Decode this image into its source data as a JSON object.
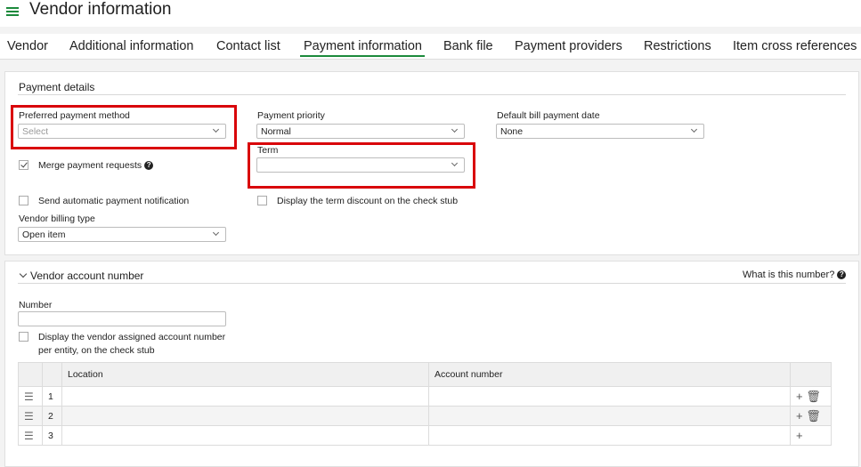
{
  "header": {
    "title": "Vendor information",
    "menu_icon": "list-menu-icon"
  },
  "tabs": [
    {
      "label": "Vendor"
    },
    {
      "label": "Additional information"
    },
    {
      "label": "Contact list"
    },
    {
      "label": "Payment information"
    },
    {
      "label": "Bank file"
    },
    {
      "label": "Payment providers"
    },
    {
      "label": "Restrictions"
    },
    {
      "label": "Item cross references"
    }
  ],
  "active_tab": "Payment information",
  "payment_details": {
    "title": "Payment details",
    "preferred_method": {
      "label": "Preferred payment method",
      "placeholder": "Select"
    },
    "priority": {
      "label": "Payment priority",
      "value": "Normal"
    },
    "default_bill_date": {
      "label": "Default bill payment date",
      "value": "None"
    },
    "term": {
      "label": "Term",
      "value": ""
    },
    "merge_requests": {
      "label": "Merge payment requests",
      "checked": true
    },
    "auto_notification": {
      "label": "Send automatic payment notification",
      "checked": false
    },
    "term_discount": {
      "label": "Display the term discount on the check stub",
      "checked": false
    },
    "billing_type": {
      "label": "Vendor billing type",
      "value": "Open item"
    }
  },
  "vendor_account": {
    "title": "Vendor account number",
    "help_link": "What is this number?",
    "number_label": "Number",
    "number_value": "",
    "display_checkbox": {
      "label_line1": "Display the vendor assigned account number",
      "label_line2": "per entity, on the check stub",
      "checked": false
    },
    "table": {
      "columns": [
        "Location",
        "Account number"
      ],
      "rows": [
        {
          "num": "1",
          "location": "",
          "account": ""
        },
        {
          "num": "2",
          "location": "",
          "account": ""
        },
        {
          "num": "3",
          "location": "",
          "account": ""
        }
      ]
    }
  },
  "colors": {
    "accent": "#1c8a3c",
    "highlight": "#d9050a"
  }
}
